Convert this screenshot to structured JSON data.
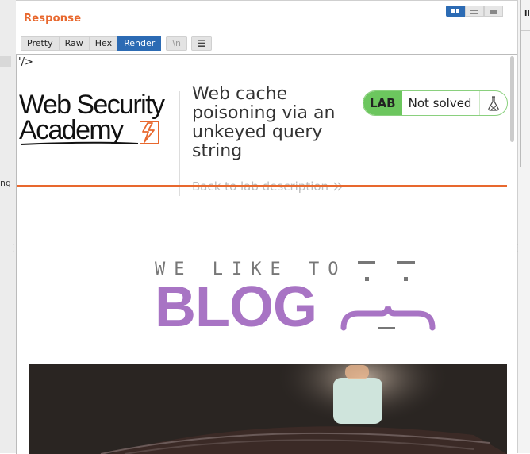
{
  "panel": {
    "title": "Response",
    "tabs": [
      "Pretty",
      "Raw",
      "Hex",
      "Render"
    ],
    "active_tab": "Render",
    "newline_toggle": "\\n",
    "menu_icon": "hamburger-icon",
    "view_toggle_icons": [
      "split-columns-icon",
      "split-rows-icon",
      "single-pane-icon"
    ]
  },
  "left_strip": {
    "fragment": "ng"
  },
  "render": {
    "stray_text": "'/>",
    "logo": {
      "line1": "Web Security",
      "line2": "Academy",
      "icon": "lightning-bolt-icon"
    },
    "lab_title": "Web cache poisoning via an unkeyed query string",
    "back_link": "Back to lab description",
    "back_link_icon": "double-chevron-right-icon",
    "lab_badge": "LAB",
    "lab_state": "Not solved",
    "lab_state_icon": "flask-icon",
    "blog": {
      "tagline": "WE LIKE TO",
      "word": "BLOG",
      "face_icon": "emoticon-face-icon"
    },
    "hero_image_icon": "candle-photo-icon"
  },
  "colors": {
    "accent_orange": "#e8682e",
    "tab_active": "#2c6bb4",
    "lab_green": "#6cc65e",
    "blog_purple": "#a874c4"
  }
}
